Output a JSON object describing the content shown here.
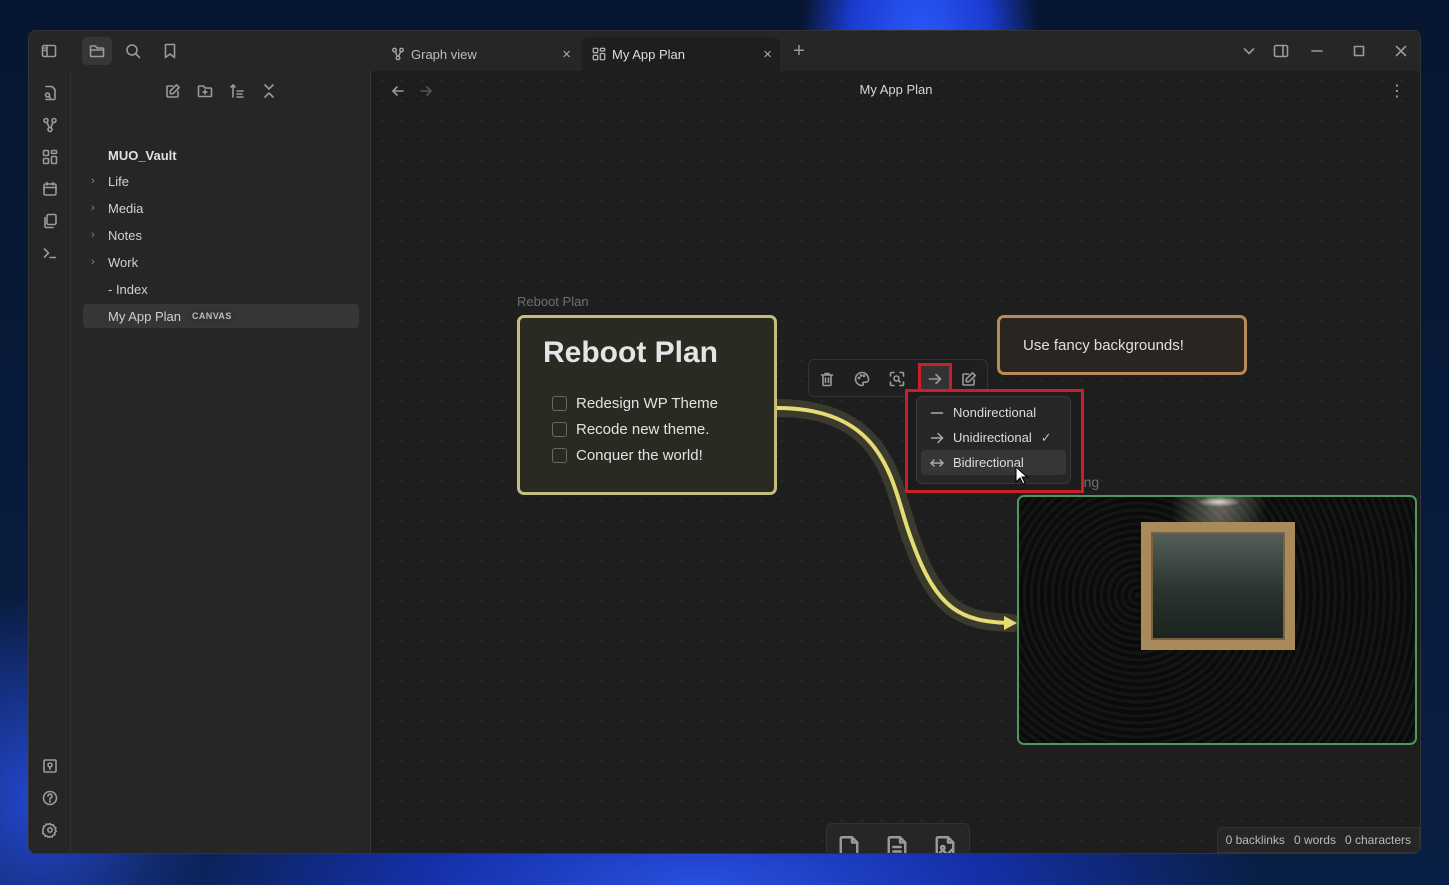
{
  "titlebar": {
    "tabs": [
      {
        "label": "Graph view",
        "icon": "graph-icon",
        "active": false
      },
      {
        "label": "My App Plan",
        "icon": "canvas-icon",
        "active": true
      }
    ],
    "new_tab_label": "+",
    "close_label": "×"
  },
  "ribbon": {
    "top": [
      "quick-switcher-icon",
      "graph-icon",
      "canvas-icon",
      "calendar-icon",
      "templates-icon",
      "terminal-icon"
    ],
    "bottom": [
      "vault-icon",
      "help-icon",
      "settings-icon"
    ]
  },
  "file_explorer": {
    "vault_name": "MUO_Vault",
    "items": [
      {
        "label": "Life",
        "type": "folder"
      },
      {
        "label": "Media",
        "type": "folder"
      },
      {
        "label": "Notes",
        "type": "folder"
      },
      {
        "label": "Work",
        "type": "folder"
      },
      {
        "label": "- Index",
        "type": "file"
      },
      {
        "label": "My App Plan",
        "type": "file",
        "badge": "CANVAS",
        "selected": true
      }
    ]
  },
  "view_header": {
    "title": "My App Plan"
  },
  "canvas": {
    "group_label": "Reboot Plan",
    "reboot_card": {
      "heading": "Reboot Plan",
      "tasks": [
        "Redesign WP Theme",
        "Recode new theme.",
        "Conquer the world!"
      ],
      "border_color": "#c5bd7c"
    },
    "fancy_card": {
      "text": "Use fancy backgrounds!",
      "border_color": "#b88a55"
    },
    "image_node": {
      "label": "art_frame.png",
      "border_color": "#4f9a5a"
    },
    "edge_color": "#e5dc74",
    "edge_toolbar": [
      "trash-icon",
      "palette-icon",
      "zoom-to-selection-icon",
      "arrow-direction-icon",
      "edit-label-icon"
    ],
    "direction_menu": {
      "items": [
        {
          "label": "Nondirectional",
          "icon": "line-icon",
          "checked": false
        },
        {
          "label": "Unidirectional",
          "icon": "arrow-right-icon",
          "checked": true
        },
        {
          "label": "Bidirectional",
          "icon": "arrow-both-icon",
          "checked": false,
          "hovered": true
        }
      ],
      "check_mark": "✓"
    },
    "highlight_color": "#c8202a"
  },
  "status_bar": {
    "backlinks": "0 backlinks",
    "words": "0 words",
    "characters": "0 characters"
  }
}
